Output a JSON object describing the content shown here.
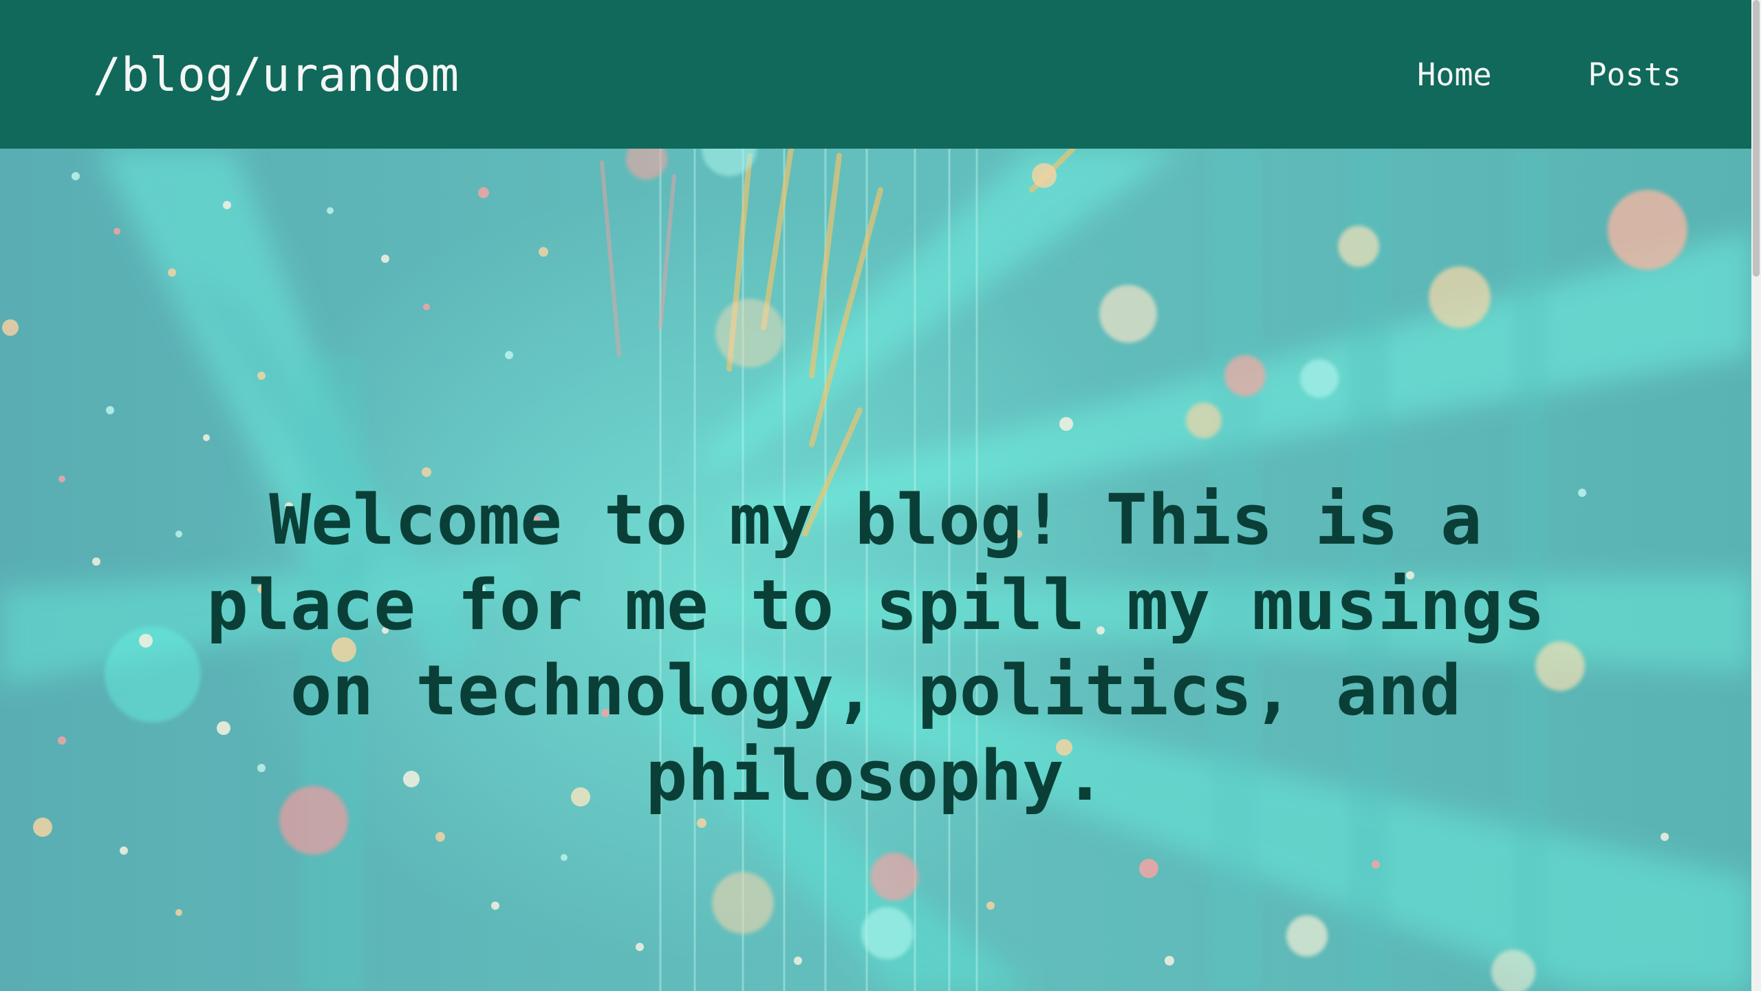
{
  "header": {
    "brand": "/blog/urandom",
    "nav": [
      {
        "label": "Home"
      },
      {
        "label": "Posts"
      }
    ]
  },
  "hero": {
    "headline": "Welcome to my blog! This is a place for me to spill my musings on technology, politics, and philosophy.",
    "background_icon": "abstract-light-tunnel-image"
  },
  "colors": {
    "navbar": "#10695a",
    "nav_text": "#f4f6f5",
    "headline": "#0a3f37",
    "hero_base": "#5fb3b4",
    "hero_glow": "#52e8d6"
  }
}
